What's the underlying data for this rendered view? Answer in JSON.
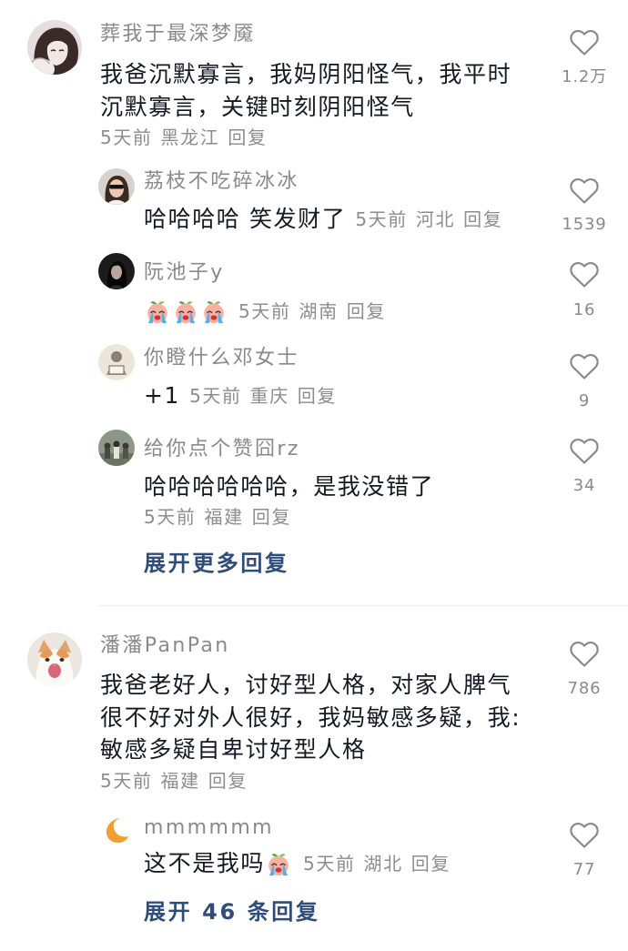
{
  "colors": {
    "background": "#ffffff",
    "username": "#8a8a8a",
    "text": "#161823",
    "meta": "#8d8d8d",
    "expand_link": "#2f4d7b",
    "like_icon": "#8a8a8a",
    "divider": "#ececec"
  },
  "comments": [
    {
      "avatar_icon": "anime-girl-avatar",
      "username": "葬我于最深梦魇",
      "text_lines": [
        "我爸沉默寡言，我妈阴阳怪气，我平时",
        "沉默寡言，关键时刻阴阳怪气"
      ],
      "time": "5天前",
      "location": "黑龙江",
      "reply_label": "回复",
      "like_icon": "heart-outline-icon",
      "like_count": "1.2万",
      "replies": [
        {
          "avatar_icon": "sunglasses-person-avatar",
          "username": "荔枝不吃碎冰冰",
          "text": "哈哈哈哈 笑发财了",
          "time": "5天前",
          "location": "河北",
          "reply_label": "回复",
          "like_icon": "heart-outline-icon",
          "like_count": "1539"
        },
        {
          "avatar_icon": "dark-portrait-avatar",
          "username": "阮池子y",
          "emojis": [
            "crying-sprout-emoji",
            "crying-sprout-emoji",
            "crying-sprout-emoji"
          ],
          "time": "5天前",
          "location": "湖南",
          "reply_label": "回复",
          "like_icon": "heart-outline-icon",
          "like_count": "16"
        },
        {
          "avatar_icon": "sketch-reader-avatar",
          "username": "你瞪什么邓女士",
          "text": "+1",
          "time": "5天前",
          "location": "重庆",
          "reply_label": "回复",
          "like_icon": "heart-outline-icon",
          "like_count": "9"
        },
        {
          "avatar_icon": "group-photo-avatar",
          "username": "给你点个赞囧rz",
          "text": "哈哈哈哈哈哈，是我没错了",
          "time": "5天前",
          "location": "福建",
          "reply_label": "回复",
          "like_icon": "heart-outline-icon",
          "like_count": "34"
        }
      ],
      "expand_label": "展开更多回复"
    },
    {
      "avatar_icon": "orange-white-cat-avatar",
      "username": "潘潘PanPan",
      "text_lines": [
        "我爸老好人，讨好型人格，对家人脾气",
        "很不好对外人很好，我妈敏感多疑，我:",
        "敏感多疑自卑讨好型人格"
      ],
      "time": "5天前",
      "location": "福建",
      "reply_label": "回复",
      "like_icon": "heart-outline-icon",
      "like_count": "786",
      "replies": [
        {
          "avatar_icon": "crescent-moon-avatar",
          "username": "mmmmmm",
          "text": "这不是我吗",
          "emojis": [
            "crying-sprout-emoji"
          ],
          "time": "5天前",
          "location": "湖北",
          "reply_label": "回复",
          "like_icon": "heart-outline-icon",
          "like_count": "77"
        }
      ],
      "expand_label": "展开 46 条回复"
    }
  ]
}
